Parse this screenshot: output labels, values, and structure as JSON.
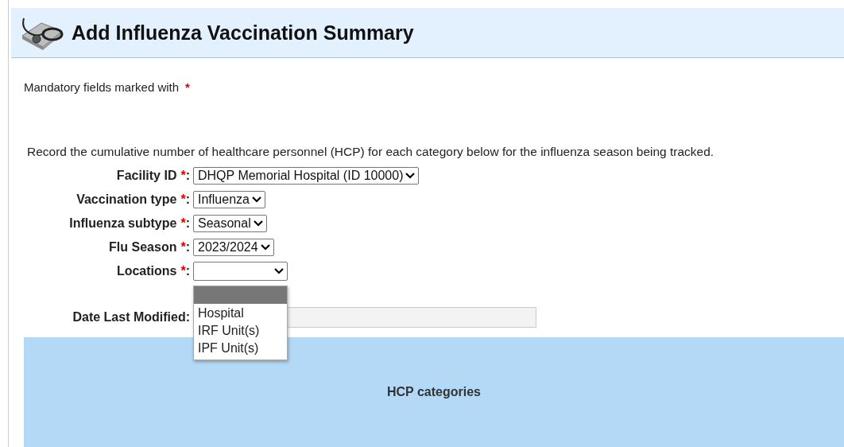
{
  "header": {
    "title": "Add Influenza Vaccination Summary"
  },
  "mandatory_note": "Mandatory fields marked with",
  "mandatory_mark": "*",
  "label_suffix": ":",
  "instructions": "Record the cumulative number of healthcare personnel (HCP) for each category below for the influenza season being tracked.",
  "fields": [
    {
      "label": "Facility ID",
      "required": true,
      "value": "DHQP Memorial Hospital (ID 10000)"
    },
    {
      "label": "Vaccination type",
      "required": true,
      "value": "Influenza"
    },
    {
      "label": "Influenza subtype",
      "required": true,
      "value": "Seasonal"
    },
    {
      "label": "Flu Season",
      "required": true,
      "value": "2023/2024"
    },
    {
      "label": "Locations",
      "required": true,
      "open": true
    }
  ],
  "locations_dropdown": {
    "blank_option_highlighted": true,
    "options": [
      {
        "label": "Hospital",
        "selected": false
      },
      {
        "label": "IRF Unit(s)",
        "selected": false
      },
      {
        "label": "IPF Unit(s)",
        "selected": false
      }
    ]
  },
  "date_last_modified": {
    "label": "Date Last Modified:"
  },
  "hcp_panel": {
    "title": "HCP categories"
  }
}
